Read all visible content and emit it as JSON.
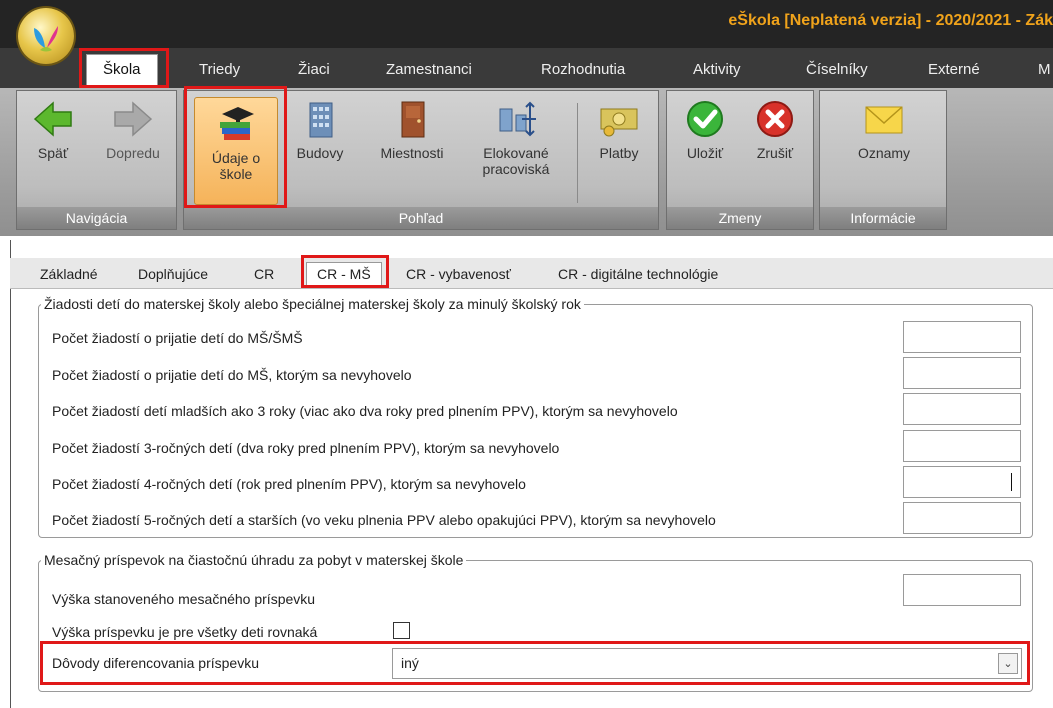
{
  "window": {
    "title": "eŠkola [Neplatená verzia] - 2020/2021 - Zák"
  },
  "menu": [
    "Škola",
    "Triedy",
    "Žiaci",
    "Zamestnanci",
    "Rozhodnutia",
    "Aktivity",
    "Číselníky",
    "Externé",
    "M"
  ],
  "ribbon": {
    "navigacia": {
      "label": "Navigácia",
      "back": "Späť",
      "forward": "Dopredu"
    },
    "pohlad": {
      "label": "Pohľad",
      "udaje1": "Údaje o",
      "udaje2": "škole",
      "budovy": "Budovy",
      "miestnosti": "Miestnosti",
      "elok1": "Elokované",
      "elok2": "pracoviská",
      "platby": "Platby"
    },
    "zmeny": {
      "label": "Zmeny",
      "save": "Uložiť",
      "cancel": "Zrušiť"
    },
    "informacie": {
      "label": "Informácie",
      "oznamy": "Oznamy"
    }
  },
  "subtabs": [
    "Základné",
    "Doplňujúce",
    "CR",
    "CR - MŠ",
    "CR - vybavenosť",
    "CR - digitálne technológie"
  ],
  "section1": {
    "legend": "Žiadosti detí do materskej školy alebo špeciálnej materskej školy za minulý školský rok",
    "rows": [
      "Počet žiadostí o prijatie detí do MŠ/ŠMŠ",
      "Počet žiadostí o prijatie detí do MŠ, ktorým sa nevyhovelo",
      "Počet žiadostí detí mladších ako 3 roky (viac ako dva roky pred plnením PPV), ktorým sa nevyhovelo",
      "Počet žiadostí 3-ročných detí (dva roky pred plnením PPV), ktorým sa nevyhovelo",
      "Počet žiadostí 4-ročných detí (rok pred plnením PPV), ktorým sa nevyhovelo",
      "Počet žiadostí 5-ročných detí a starších (vo veku plnenia PPV alebo opakujúci PPV), ktorým sa nevyhovelo"
    ]
  },
  "section2": {
    "legend": "Mesačný príspevok na čiastočnú úhradu za pobyt v materskej škole",
    "amount_label": "Výška stanoveného mesačného príspevku",
    "equal_label": "Výška príspevku je pre všetky deti rovnaká",
    "reasons_label": "Dôvody diferencovania príspevku",
    "reasons_value": "iný"
  },
  "colors": {
    "accent": "#f0a31b",
    "highlight": "#e01818"
  }
}
